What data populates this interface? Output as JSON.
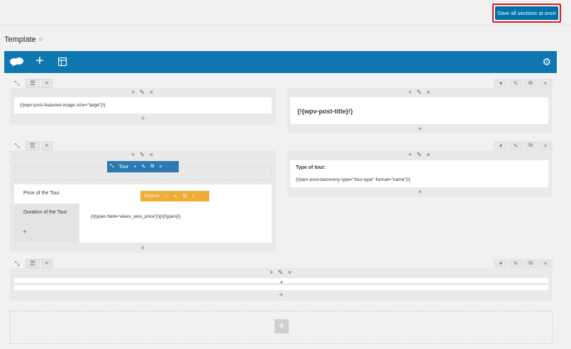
{
  "header": {
    "save_all_label": "Save all sections at once"
  },
  "template": {
    "title": "Template"
  },
  "toolbar": {
    "logo_icon": "cloud-logo-icon",
    "add_icon": "plus-icon",
    "layout_icon": "layout-icon",
    "settings_icon": "gear-icon"
  },
  "rows": [
    {
      "left_cell": {
        "code": "{!{wpv-post-featured-image size=\"large\"}!}"
      },
      "right_cell": {
        "code": "{!{wpv-post-title}!}"
      }
    },
    {
      "left": {
        "tour_toolbar_label": "Tour",
        "section_toolbar_label": "Section",
        "tabs": [
          "Price of the Tour",
          "Duration of the Tour"
        ],
        "add_tab": "+",
        "tab_content": "{!{types field='views_woo_price'}!}{!{/types}!}"
      },
      "right_cell": {
        "label": "Type of tour:",
        "code": "{!{wpv-post-taxonomy type=\"tour-type\" format=\"name\"}!}"
      }
    }
  ],
  "add_symbol": "+",
  "ctl_icons": "+ ✎ ×"
}
